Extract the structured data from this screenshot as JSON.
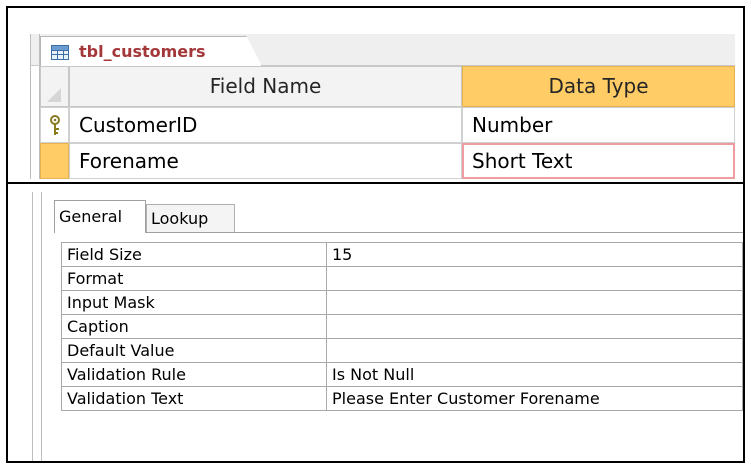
{
  "document_tab": {
    "title": "tbl_customers",
    "icon": "table-icon"
  },
  "grid": {
    "columns": {
      "field_name": "Field Name",
      "data_type": "Data Type"
    },
    "rows": [
      {
        "field_name": "CustomerID",
        "data_type": "Number",
        "primary_key": true,
        "icon": "key-icon"
      },
      {
        "field_name": "Forename",
        "data_type": "Short Text",
        "selected": true
      }
    ]
  },
  "properties": {
    "tabs": [
      "General",
      "Lookup"
    ],
    "active_tab": "General",
    "rows": [
      {
        "label": "Field Size",
        "value": "15"
      },
      {
        "label": "Format",
        "value": ""
      },
      {
        "label": "Input Mask",
        "value": ""
      },
      {
        "label": "Caption",
        "value": ""
      },
      {
        "label": "Default Value",
        "value": ""
      },
      {
        "label": "Validation Rule",
        "value": "Is Not Null"
      },
      {
        "label": "Validation Text",
        "value": "Please Enter Customer Forename"
      }
    ]
  },
  "colors": {
    "selection_gold": "#ffcc66",
    "tab_title_red": "#a4373a",
    "active_cell_border": "#ee9ca0"
  }
}
